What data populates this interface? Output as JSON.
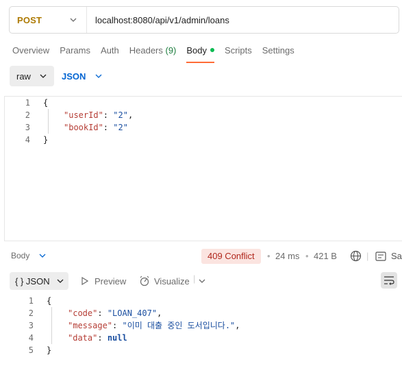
{
  "request": {
    "method": "POST",
    "url": "localhost:8080/api/v1/admin/loans"
  },
  "tabs": [
    {
      "label": "Overview"
    },
    {
      "label": "Params"
    },
    {
      "label": "Auth"
    },
    {
      "label": "Headers",
      "count": "(9)"
    },
    {
      "label": "Body",
      "active": true
    },
    {
      "label": "Scripts"
    },
    {
      "label": "Settings"
    }
  ],
  "body_options": {
    "mode": "raw",
    "language": "JSON"
  },
  "request_body": {
    "line_numbers": [
      "1",
      "2",
      "3",
      "4"
    ],
    "open_brace": "{",
    "close_brace": "}",
    "fields": [
      {
        "key": "\"userId\"",
        "value": "\"2\"",
        "trail": ","
      },
      {
        "key": "\"bookId\"",
        "value": "\"2\"",
        "trail": ""
      }
    ]
  },
  "response": {
    "section_label": "Body",
    "status": "409 Conflict",
    "time": "24 ms",
    "size": "421 B",
    "save_label": "Sa",
    "format": "{ } JSON",
    "preview_label": "Preview",
    "visualize_label": "Visualize",
    "line_numbers": [
      "1",
      "2",
      "3",
      "4",
      "5"
    ],
    "open_brace": "{",
    "close_brace": "}",
    "fields": [
      {
        "key": "\"code\"",
        "value": "\"LOAN_407\"",
        "trail": ",",
        "kind": "str"
      },
      {
        "key": "\"message\"",
        "value": "\"이미 대출 중인 도서입니다.\"",
        "trail": ",",
        "kind": "str"
      },
      {
        "key": "\"data\"",
        "value": "null",
        "trail": "",
        "kind": "kw"
      }
    ]
  },
  "colors": {
    "method": "#ad7a03",
    "accent": "#ff6c37",
    "status_bg": "#fbe4e0",
    "status_text": "#b0261b",
    "link": "#0265d2"
  }
}
